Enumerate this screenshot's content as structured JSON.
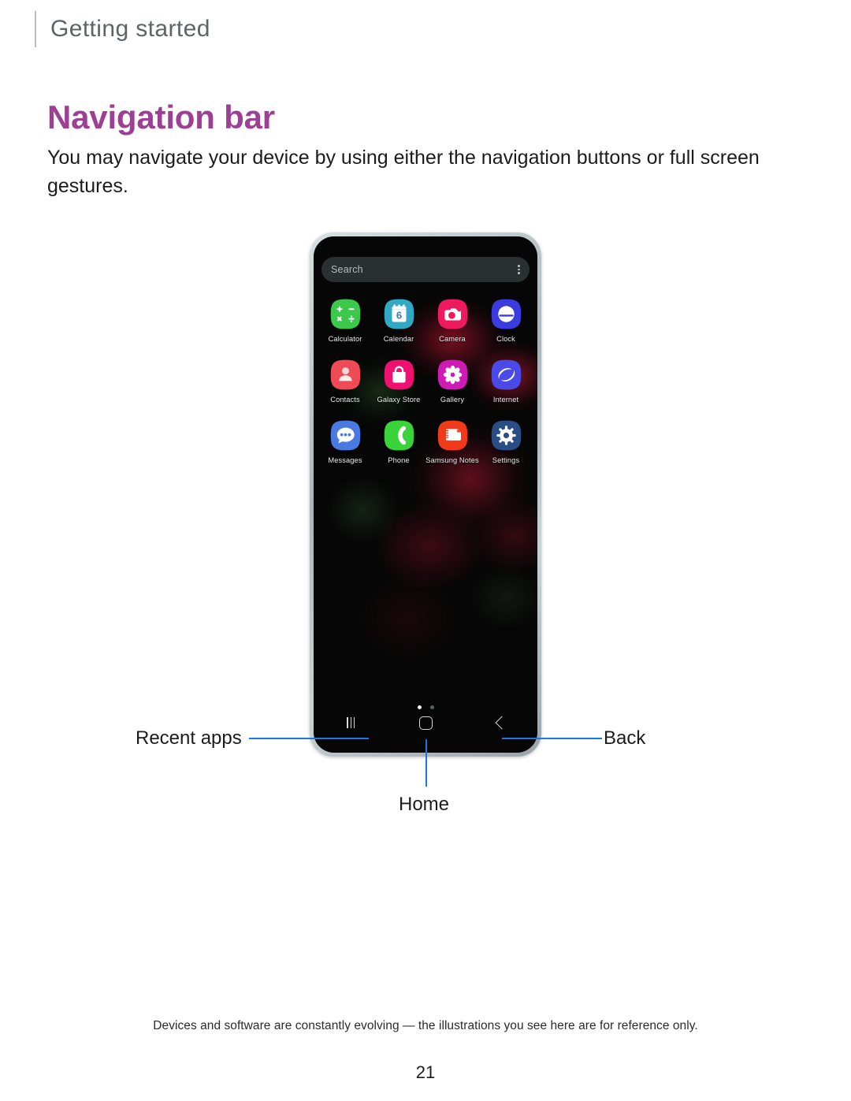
{
  "header": {
    "running_label": "Getting started"
  },
  "title": "Navigation bar",
  "intro": "You may navigate your device by using either the navigation buttons or full screen gestures.",
  "colors": {
    "title_magenta": "#9d3f93",
    "callout_blue": "#1878e0",
    "header_gray": "#5c6468",
    "rule_gray": "#b9bfc2"
  },
  "phone": {
    "search": {
      "placeholder": "Search",
      "overflow_icon": "more-vertical-icon"
    },
    "apps": [
      {
        "label": "Calculator",
        "icon": "calculator-icon",
        "bg": "#3cc84a"
      },
      {
        "label": "Calendar",
        "icon": "calendar-icon",
        "bg": "#31a8c4"
      },
      {
        "label": "Camera",
        "icon": "camera-icon",
        "bg": "#ee1a5f"
      },
      {
        "label": "Clock",
        "icon": "clock-icon",
        "bg": "#3a3ce0"
      },
      {
        "label": "Contacts",
        "icon": "contacts-icon",
        "bg": "#ef4a55"
      },
      {
        "label": "Galaxy Store",
        "icon": "galaxy-store-icon",
        "bg": "#ef1070"
      },
      {
        "label": "Gallery",
        "icon": "gallery-icon",
        "bg": "#d01ab6"
      },
      {
        "label": "Internet",
        "icon": "internet-icon",
        "bg": "#4a4ae8"
      },
      {
        "label": "Messages",
        "icon": "messages-icon",
        "bg": "#4a7ae0"
      },
      {
        "label": "Phone",
        "icon": "phone-icon",
        "bg": "#3ad43a"
      },
      {
        "label": "Samsung Notes",
        "icon": "samsung-notes-icon",
        "bg": "#f03a1a"
      },
      {
        "label": "Settings",
        "icon": "settings-icon",
        "bg": "#2a4d86"
      }
    ],
    "page_dots": {
      "total": 2,
      "active_index": 0
    },
    "nav_buttons": [
      {
        "name": "recent-apps-button",
        "icon": "recent-apps-icon"
      },
      {
        "name": "home-button",
        "icon": "home-icon"
      },
      {
        "name": "back-button",
        "icon": "back-icon"
      }
    ]
  },
  "callouts": {
    "recent_apps": "Recent apps",
    "home": "Home",
    "back": "Back"
  },
  "footer": {
    "note": "Devices and software are constantly evolving — the illustrations you see here are for reference only.",
    "page_number": "21"
  }
}
